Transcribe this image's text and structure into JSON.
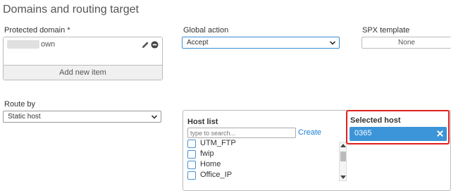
{
  "section": {
    "title": "Domains and routing target"
  },
  "protected_domain": {
    "label": "Protected domain *",
    "entries": [
      "own"
    ],
    "add_label": "Add new item"
  },
  "global_action": {
    "label": "Global action",
    "value": "Accept"
  },
  "spx_template": {
    "label": "SPX template",
    "value": "None"
  },
  "route_by": {
    "label": "Route by",
    "value": "Static host"
  },
  "host_list": {
    "title": "Host list",
    "search_placeholder": "type to search...",
    "create_label": "Create",
    "items": [
      "UTM_FTP",
      "fwip",
      "Home",
      "Office_IP"
    ]
  },
  "selected_host": {
    "title": "Selected host",
    "value": "0365"
  },
  "colors": {
    "accent": "#3c94d9",
    "highlight": "#e02020",
    "link": "#1a7fd4"
  }
}
